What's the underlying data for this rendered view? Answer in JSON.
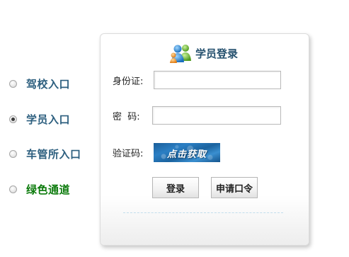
{
  "nav": {
    "items": [
      {
        "label": "驾校入口",
        "selected": false
      },
      {
        "label": "学员入口",
        "selected": true
      },
      {
        "label": "车管所入口",
        "selected": false
      },
      {
        "label": "绿色通道",
        "selected": false
      }
    ]
  },
  "panel": {
    "title": "学员登录",
    "icon": "users-icon",
    "fields": {
      "id_label": "身份证:",
      "id_value": "",
      "password_label": "密  码:",
      "password_value": "",
      "captcha_label": "验证码:",
      "captcha_text": "点击获取"
    },
    "buttons": {
      "login": "登录",
      "apply": "申请口令"
    }
  },
  "colors": {
    "nav_label": "#2d5f7f",
    "nav_green": "#0a7a0a",
    "title": "#24506e",
    "captcha_bg": "#2b7fc4"
  }
}
